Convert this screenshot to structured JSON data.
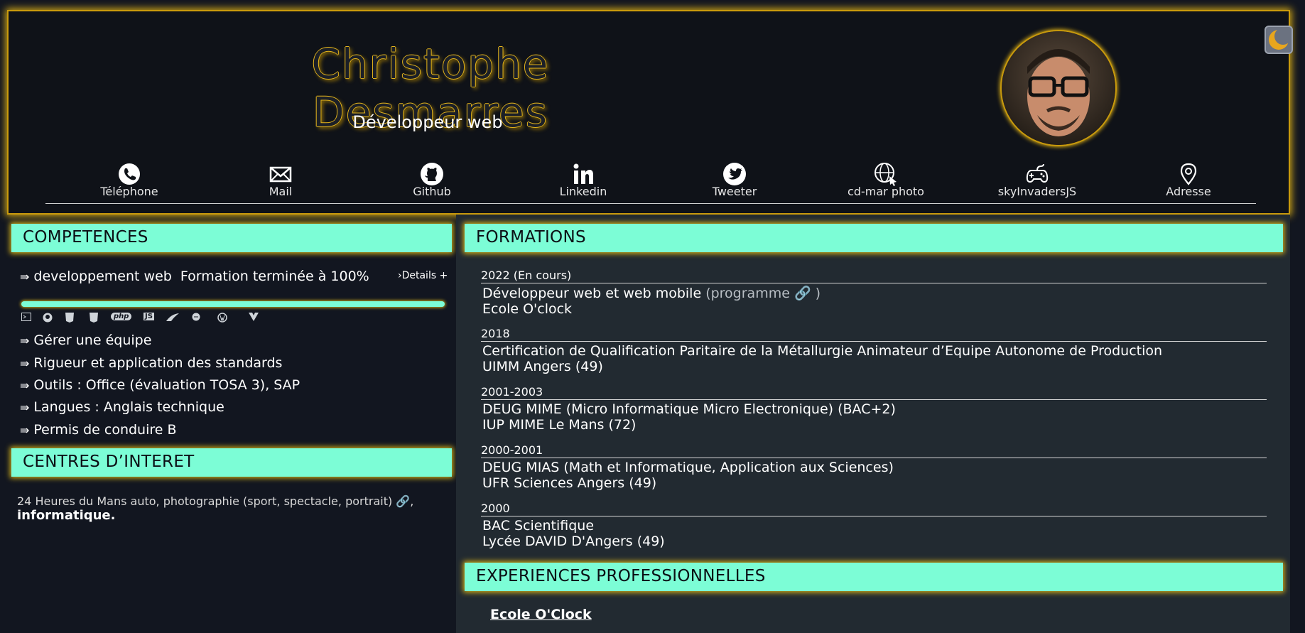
{
  "header": {
    "name": "Christophe Desmarres",
    "subtitle": "Développeur web",
    "avatar_alt": "Photo de profil",
    "theme_toggle_icon": "moon-icon",
    "contacts": [
      {
        "label": "Téléphone",
        "icon": "phone-icon"
      },
      {
        "label": "Mail",
        "icon": "mail-icon"
      },
      {
        "label": "Github",
        "icon": "github-icon"
      },
      {
        "label": "Linkedin",
        "icon": "linkedin-icon"
      },
      {
        "label": "Tweeter",
        "icon": "twitter-icon"
      },
      {
        "label": "cd-mar photo",
        "icon": "globe-www-icon"
      },
      {
        "label": "skyInvadersJS",
        "icon": "gamepad-icon"
      },
      {
        "label": "Adresse",
        "icon": "map-pin-icon"
      }
    ]
  },
  "competences": {
    "title": "COMPETENCES",
    "main_item": "developpement web",
    "main_status": "Formation terminée à 100%",
    "details_label": "›Details +",
    "progress_fraction": 1.0,
    "tech_icons": [
      "terminal-icon",
      "github-icon",
      "html5-icon",
      "css3-icon",
      "php-icon",
      "js-icon",
      "symfony-icon",
      "api-icon",
      "wordpress-icon",
      "vue-icon"
    ],
    "tech_labels": {
      "php": "php",
      "js": "JS"
    },
    "items": [
      "Gérer une équipe",
      "Rigueur et application des standards",
      "Outils : Office (évaluation TOSA 3), SAP",
      "Langues : Anglais technique",
      "Permis de conduire B"
    ]
  },
  "interests": {
    "title": "CENTRES D’INTERET",
    "text": "24 Heures du Mans auto, photographie (sport, spectacle, portrait)",
    "suffix": ",",
    "bold": "informatique."
  },
  "formations": {
    "title": "FORMATIONS",
    "items": [
      {
        "year": "2022 (En cours)",
        "line1": "Développeur web et web mobile",
        "line1_extra": "(programme",
        "line1_close": ")",
        "line2": "Ecole O'clock"
      },
      {
        "year": "2018",
        "line1": "Certification de Qualification Paritaire de la Métallurgie Animateur d’Equipe Autonome de Production",
        "line2": "UIMM Angers (49)"
      },
      {
        "year": "2001-2003",
        "line1": "DEUG MIME (Micro Informatique Micro Electronique) (BAC+2)",
        "line2": "IUP MIME Le Mans (72)"
      },
      {
        "year": "2000-2001",
        "line1": "DEUG MIAS (Math et Informatique, Application aux Sciences)",
        "line2": "UFR Sciences Angers (49)"
      },
      {
        "year": "2000",
        "line1": "BAC Scientifique",
        "line2": "Lycée DAVID D'Angers (49)"
      }
    ]
  },
  "experiences": {
    "title": "EXPERIENCES PROFESSIONNELLES",
    "first_company": "Ecole O'Clock"
  },
  "colors": {
    "accent": "#7cfdd6",
    "gold": "#d3a816",
    "background": "#121620",
    "panel": "#222a31"
  }
}
